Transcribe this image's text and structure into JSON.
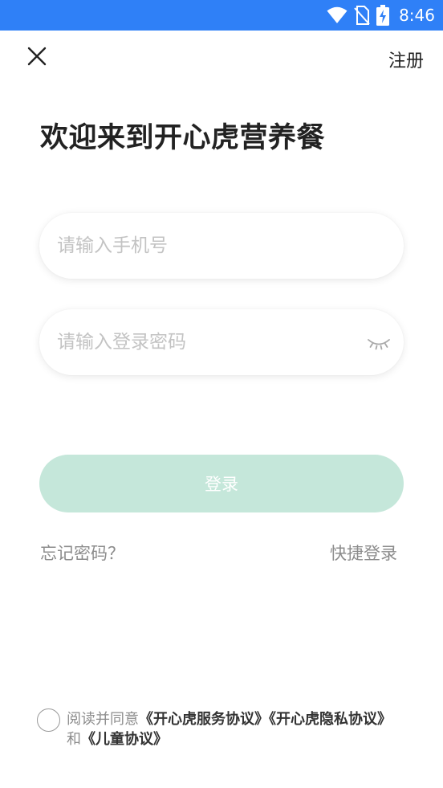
{
  "status_bar": {
    "time": "8:46",
    "icons": [
      "wifi-icon",
      "no-sim-icon",
      "battery-charging-icon"
    ]
  },
  "header": {
    "close_icon": "close-icon",
    "register_label": "注册"
  },
  "welcome_title": "欢迎来到开心虎营养餐",
  "form": {
    "phone_placeholder": "请输入手机号",
    "phone_value": "",
    "password_placeholder": "请输入登录密码",
    "password_value": "",
    "password_toggle_icon": "eye-closed-icon",
    "login_label": "登录"
  },
  "links": {
    "forgot_password": "忘记密码？",
    "quick_login": "快捷登录"
  },
  "agreement": {
    "prefix": "阅读并同意",
    "service_agreement": "《开心虎服务协议》",
    "privacy_agreement": "《开心虎隐私协议》",
    "conjunction": "和",
    "children_agreement": "《儿童协议》"
  },
  "colors": {
    "status_bar": "#2f80f7",
    "login_button_disabled": "#c5e7da",
    "muted_text": "#8c8c8c",
    "title_text": "#222222"
  }
}
